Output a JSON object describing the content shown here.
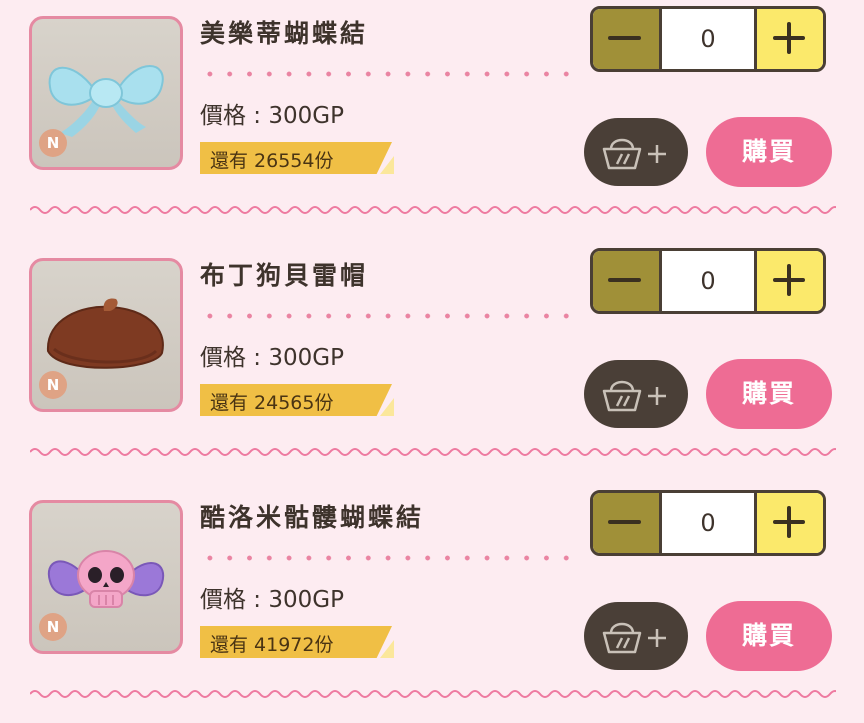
{
  "items": [
    {
      "name": "美樂蒂蝴蝶結",
      "rarity": "N",
      "price": "價格 : 300GP",
      "stock": "還有 26554份",
      "quantity": "0",
      "buy_label": "購買",
      "icon": "blue-bow"
    },
    {
      "name": "布丁狗貝雷帽",
      "rarity": "N",
      "price": "價格 : 300GP",
      "stock": "還有 24565份",
      "quantity": "0",
      "buy_label": "購買",
      "icon": "brown-beret"
    },
    {
      "name": "酷洛米骷髏蝴蝶結",
      "rarity": "N",
      "price": "價格 : 300GP",
      "stock": "還有 41972份",
      "quantity": "0",
      "buy_label": "購買",
      "icon": "skull-bow"
    }
  ],
  "icons": {
    "cart": "basket-plus-icon",
    "minus": "minus-icon",
    "plus": "plus-icon"
  },
  "colors": {
    "background": "#fdecf1",
    "accent_pink": "#ee6c94",
    "minus_button": "#a09038",
    "plus_button": "#fbe96b",
    "stock_tag": "#f0bf45",
    "cart_button": "#4a3f37"
  }
}
